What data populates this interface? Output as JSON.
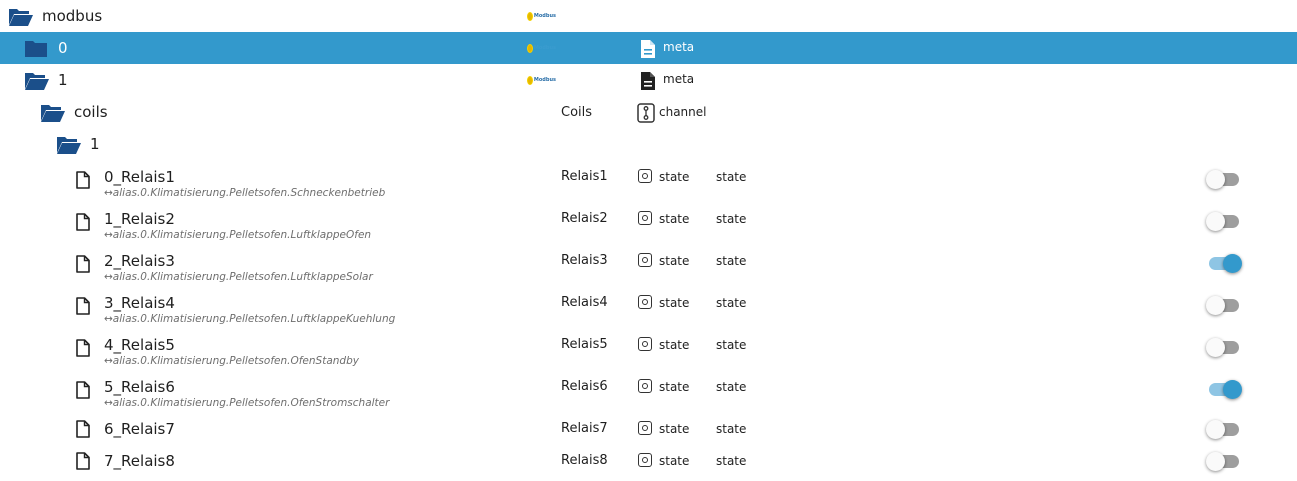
{
  "tree": {
    "root": {
      "name": "modbus",
      "logo_text": "Modbus"
    },
    "instance0": {
      "name": "0",
      "logo_text": "Modbus",
      "type": "meta"
    },
    "instance1": {
      "name": "1",
      "logo_text": "Modbus",
      "type": "meta"
    },
    "coils": {
      "name": "coils",
      "common_name": "Coils",
      "type": "channel"
    },
    "coils_group": {
      "name": "1"
    },
    "states": [
      {
        "id": "0_Relais1",
        "alias": "↔alias.0.Klimatisierung.Pelletsofen.Schneckenbetrieb",
        "common_name": "Relais1",
        "type": "state",
        "role": "state",
        "value": false
      },
      {
        "id": "1_Relais2",
        "alias": "↔alias.0.Klimatisierung.Pelletsofen.LuftklappeOfen",
        "common_name": "Relais2",
        "type": "state",
        "role": "state",
        "value": false
      },
      {
        "id": "2_Relais3",
        "alias": "↔alias.0.Klimatisierung.Pelletsofen.LuftklappeSolar",
        "common_name": "Relais3",
        "type": "state",
        "role": "state",
        "value": true
      },
      {
        "id": "3_Relais4",
        "alias": "↔alias.0.Klimatisierung.Pelletsofen.LuftklappeKuehlung",
        "common_name": "Relais4",
        "type": "state",
        "role": "state",
        "value": false
      },
      {
        "id": "4_Relais5",
        "alias": "↔alias.0.Klimatisierung.Pelletsofen.OfenStandby",
        "common_name": "Relais5",
        "type": "state",
        "role": "state",
        "value": false
      },
      {
        "id": "5_Relais6",
        "alias": "↔alias.0.Klimatisierung.Pelletsofen.OfenStromschalter",
        "common_name": "Relais6",
        "type": "state",
        "role": "state",
        "value": true
      },
      {
        "id": "6_Relais7",
        "alias": "",
        "common_name": "Relais7",
        "type": "state",
        "role": "state",
        "value": false
      },
      {
        "id": "7_Relais8",
        "alias": "",
        "common_name": "Relais8",
        "type": "state",
        "role": "state",
        "value": false
      }
    ]
  },
  "colors": {
    "selected_bg": "#3399cc",
    "folder": "#1b4f8a",
    "switch_on": "#3399cc",
    "switch_off_track": "#9e9e9e"
  }
}
